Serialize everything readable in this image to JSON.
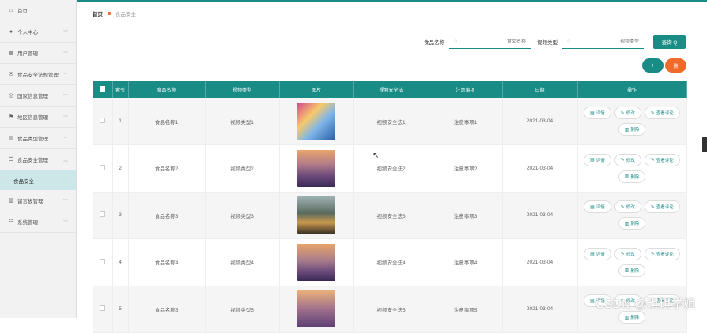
{
  "sidebar": {
    "items": [
      {
        "label": "首页",
        "icon": "home-icon",
        "glyph": "⌂",
        "chevron": false
      },
      {
        "label": "个人中心",
        "icon": "user-icon",
        "glyph": "●",
        "chevron": true
      },
      {
        "label": "用户管理",
        "icon": "grid-icon",
        "glyph": "▦",
        "chevron": true
      },
      {
        "label": "食品安全法规管理",
        "icon": "mail-icon",
        "glyph": "✉",
        "chevron": true
      },
      {
        "label": "国家信息管理",
        "icon": "globe-icon",
        "glyph": "◎",
        "chevron": true
      },
      {
        "label": "地区信息管理",
        "icon": "flag-icon",
        "glyph": "⚑",
        "chevron": true
      },
      {
        "label": "食品类型管理",
        "icon": "store-icon",
        "glyph": "▤",
        "chevron": true
      },
      {
        "label": "食品安全管理",
        "icon": "list-icon",
        "glyph": "☰",
        "chevron": true,
        "expanded": true
      }
    ],
    "sub_item": "食品安全",
    "items_after": [
      {
        "label": "留言板管理",
        "icon": "chart-icon",
        "glyph": "▥",
        "chevron": true
      },
      {
        "label": "系统管理",
        "icon": "settings-icon",
        "glyph": "☷",
        "chevron": true
      }
    ]
  },
  "breadcrumb": {
    "home": "首页",
    "current": "食品安全"
  },
  "search": {
    "name_label": "食品名称",
    "name_placeholder": "食品名称",
    "type_label": "视频类型",
    "type_placeholder": "视频类型",
    "query_button": "查询 Q"
  },
  "actions": {
    "add": "+",
    "delete": "删"
  },
  "table": {
    "headers": [
      "",
      "索引",
      "食品名称",
      "视频类型",
      "图片",
      "视频安全法",
      "注意事项",
      "日期",
      "操作"
    ],
    "rows": [
      {
        "index": "1",
        "name": "食品名称1",
        "type": "视频类型1",
        "law": "视频安全法1",
        "note": "注意事项1",
        "date": "2021-03-04",
        "thumb": "t1"
      },
      {
        "index": "2",
        "name": "食品名称2",
        "type": "视频类型2",
        "law": "视频安全法2",
        "note": "注意事项2",
        "date": "2021-03-04",
        "thumb": "t2"
      },
      {
        "index": "3",
        "name": "食品名称3",
        "type": "视频类型3",
        "law": "视频安全法3",
        "note": "注意事项3",
        "date": "2021-03-04",
        "thumb": "t3"
      },
      {
        "index": "4",
        "name": "食品名称4",
        "type": "视频类型4",
        "law": "视频安全法4",
        "note": "注意事项4",
        "date": "2021-03-04",
        "thumb": "t4"
      },
      {
        "index": "5",
        "name": "食品名称5",
        "type": "视频类型5",
        "law": "视频安全法5",
        "note": "注意事项5",
        "date": "2021-03-04",
        "thumb": "t5"
      }
    ],
    "row_ops": {
      "detail": "详情",
      "edit": "修改",
      "comments": "查看评论",
      "delete": "删除"
    }
  },
  "watermark": "CSDN @琪琪学姐",
  "colors": {
    "accent": "#1a8c86",
    "danger": "#f06a2a"
  }
}
